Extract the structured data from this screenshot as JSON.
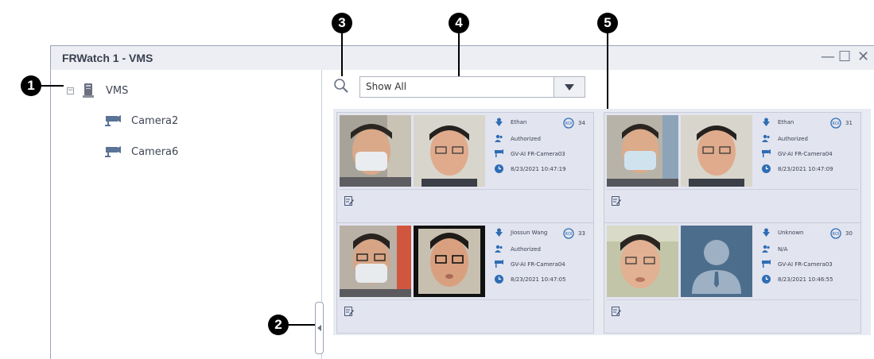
{
  "window": {
    "title": "FRWatch 1 - VMS",
    "minimize": "—",
    "maximize": "☐",
    "close": "✕"
  },
  "tree": {
    "root_label": "VMS",
    "expander": "−",
    "cameras": [
      "Camera2",
      "Camera6"
    ]
  },
  "filter": {
    "value": "Show All"
  },
  "callouts": [
    "1",
    "2",
    "3",
    "4",
    "5"
  ],
  "colors": {
    "accent_blue": "#2f6db5",
    "avatar_bg": "#4d6d8c"
  },
  "events": [
    {
      "name": "Ethan",
      "status": "Authorized",
      "camera": "GV-AI FR-Camera03",
      "time": "8/23/2021 10:47:19",
      "score": "34",
      "reference": "photo"
    },
    {
      "name": "Ethan",
      "status": "Authorized",
      "camera": "GV-AI FR-Camera04",
      "time": "8/23/2021 10:47:09",
      "score": "31",
      "reference": "photo"
    },
    {
      "name": "Jiossun Wang",
      "status": "Authorized",
      "camera": "GV-AI FR-Camera04",
      "time": "8/23/2021 10:47:05",
      "score": "33",
      "reference": "photo"
    },
    {
      "name": "Unknown",
      "status": "N/A",
      "camera": "GV-AI FR-Camera03",
      "time": "8/23/2021 10:46:55",
      "score": "30",
      "reference": "placeholder"
    }
  ]
}
